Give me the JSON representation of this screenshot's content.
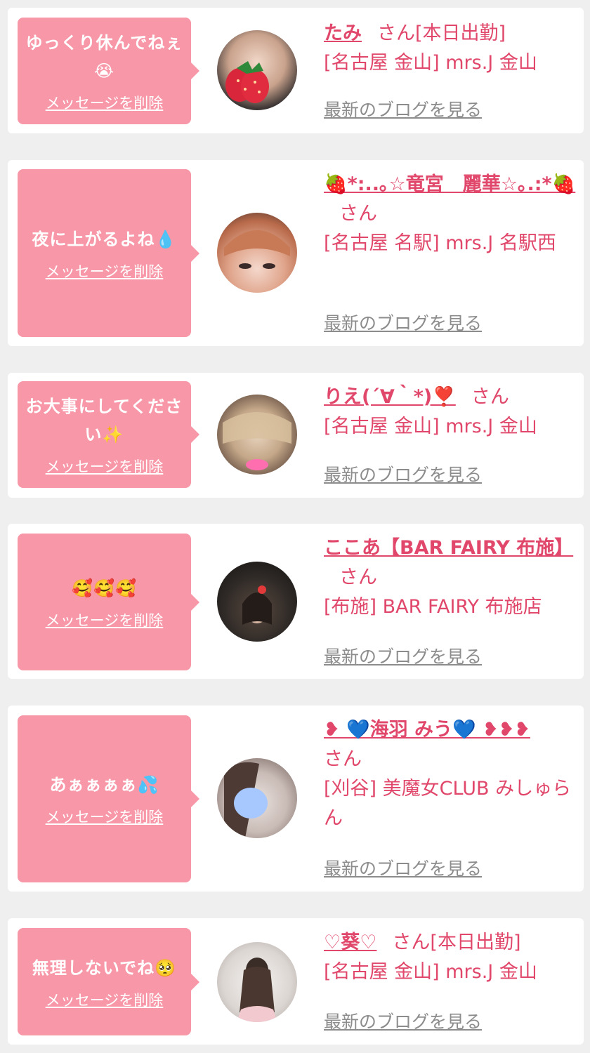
{
  "delete_label": "メッセージを削除",
  "blog_label": "最新のブログを見る",
  "san_suffix": "さん",
  "cards": [
    {
      "message": "ゆっくり休んでねぇ😭",
      "cast_name": "たみ",
      "status": "[本日出勤]",
      "shop": "[名古屋 金山] mrs.J 金山",
      "avatar_icon": "strawberry-sticker"
    },
    {
      "message": "夜に上がるよね💧",
      "cast_name": "🍓*:..｡☆竜宮　麗華☆｡.:*🍓",
      "status": "",
      "shop": "[名古屋 名駅] mrs.J 名駅西",
      "avatar_icon": "bangs-photo"
    },
    {
      "message": "お大事にしてください✨",
      "cast_name": "りえ(´∀｀*)❣️",
      "status": "",
      "shop": "[名古屋 金山] mrs.J 金山",
      "avatar_icon": "blonde-hair-photo"
    },
    {
      "message": "🥰🥰🥰",
      "cast_name": "ここあ【BAR FAIRY 布施】",
      "status": "",
      "shop": "[布施] BAR FAIRY 布施店",
      "avatar_icon": "dark-room-photo"
    },
    {
      "message": "あぁぁぁぁ💦",
      "cast_name": "❥ 💙海羽 みう💙 ❥❥❥",
      "status": "",
      "shop": "[刈谷] 美魔女CLUB みしゅらん",
      "avatar_icon": "blurred-face-photo"
    },
    {
      "message": "無理しないでね🥺",
      "cast_name": "♡葵♡",
      "status": "[本日出勤]",
      "shop": "[名古屋 金山] mrs.J 金山",
      "avatar_icon": "long-hair-back-photo"
    }
  ]
}
